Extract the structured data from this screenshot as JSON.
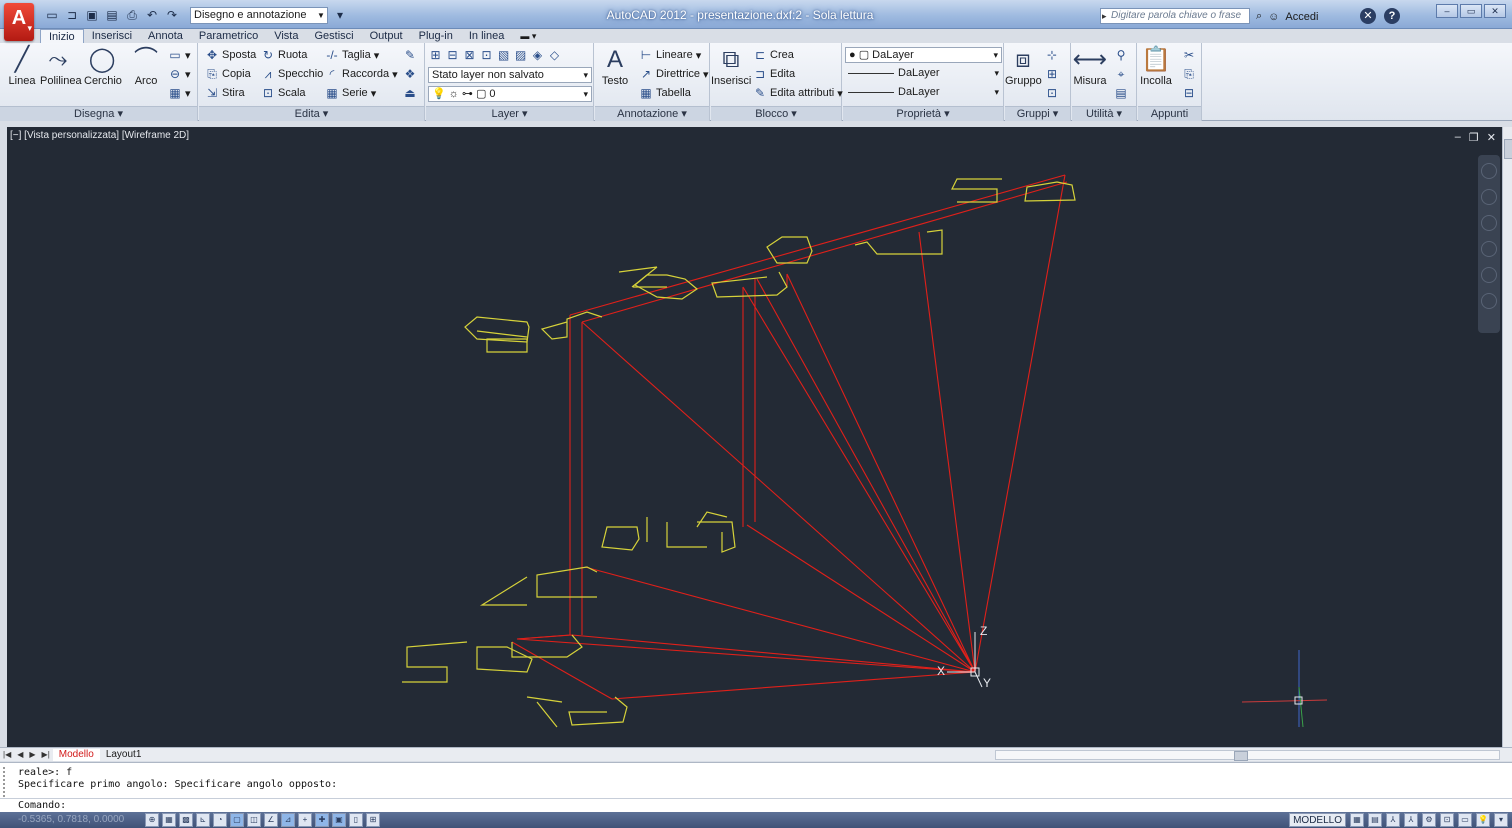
{
  "app": {
    "window_title": "AutoCAD 2012 - presentazione.dxf:2 - Sola lettura",
    "workspace": "Disegno e annotazione",
    "search_placeholder": "Digitare parola chiave o frase",
    "signin_label": "Accedi",
    "help_label": "?"
  },
  "ribbon_tabs": [
    "Inizio",
    "Inserisci",
    "Annota",
    "Parametrico",
    "Vista",
    "Gestisci",
    "Output",
    "Plug-in",
    "In linea"
  ],
  "panels": {
    "disegna": {
      "title": "Disegna ▾",
      "tools": [
        "Linea",
        "Polilinea",
        "Cerchio",
        "Arco"
      ]
    },
    "edita": {
      "title": "Edita ▾",
      "tools": [
        "Sposta",
        "Ruota",
        "Taglia",
        "Copia",
        "Specchio",
        "Raccorda",
        "Stira",
        "Scala",
        "Serie"
      ]
    },
    "layer": {
      "title": "Layer ▾",
      "state_combo": "Stato layer non salvato",
      "current_layer": "0"
    },
    "annotazione": {
      "title": "Annotazione ▾",
      "text_tool": "Testo",
      "tools": [
        "Lineare",
        "Direttrice",
        "Tabella"
      ]
    },
    "blocco": {
      "title": "Blocco ▾",
      "insert_tool": "Inserisci",
      "tools": [
        "Crea",
        "Edita",
        "Edita attributi"
      ]
    },
    "proprieta": {
      "title": "Proprietà ▾",
      "color": "DaLayer",
      "linetype": "DaLayer",
      "lineweight": "DaLayer"
    },
    "gruppi": {
      "title": "Gruppi ▾",
      "tool": "Gruppo"
    },
    "utilita": {
      "title": "Utilità ▾",
      "tool": "Misura"
    },
    "appunti": {
      "title": "Appunti",
      "tool": "Incolla"
    }
  },
  "viewport": {
    "label": "[−] [Vista personalizzata] [Wireframe 2D]",
    "ucs_x": "X",
    "ucs_y": "Y",
    "ucs_z": "Z"
  },
  "layout_tabs": [
    "Modello",
    "Layout1"
  ],
  "command_line": {
    "history": [
      "reale>: f",
      "Specificare primo angolo: Specificare angolo opposto:"
    ],
    "prompt": "Comando:"
  },
  "status": {
    "coords": "-0.5365, 0.7818, 0.0000",
    "model_label": "MODELLO"
  },
  "colors": {
    "canvas_bg": "#232a35",
    "line_red": "#e0201a",
    "text_yellow": "#d6d23a"
  }
}
